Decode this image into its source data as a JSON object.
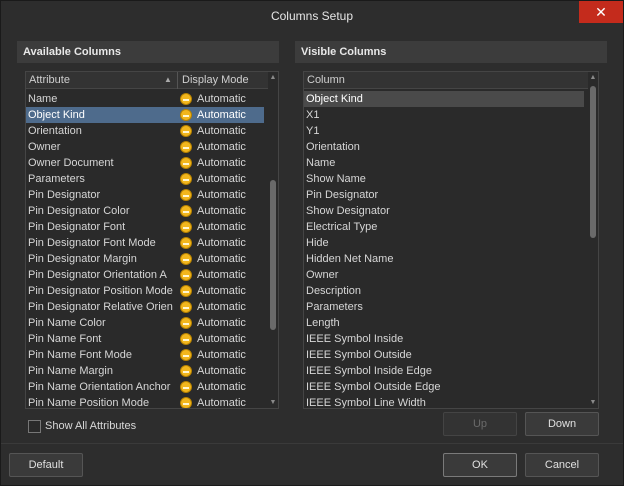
{
  "window": {
    "title": "Columns Setup"
  },
  "available": {
    "header": "Available Columns",
    "col_attribute": "Attribute",
    "col_display_mode": "Display Mode",
    "rows": [
      {
        "name": "Name",
        "mode": "Automatic"
      },
      {
        "name": "Object Kind",
        "mode": "Automatic",
        "selected": true
      },
      {
        "name": "Orientation",
        "mode": "Automatic"
      },
      {
        "name": "Owner",
        "mode": "Automatic"
      },
      {
        "name": "Owner Document",
        "mode": "Automatic"
      },
      {
        "name": "Parameters",
        "mode": "Automatic"
      },
      {
        "name": "Pin Designator",
        "mode": "Automatic"
      },
      {
        "name": "Pin Designator Color",
        "mode": "Automatic"
      },
      {
        "name": "Pin Designator Font",
        "mode": "Automatic"
      },
      {
        "name": "Pin Designator Font Mode",
        "mode": "Automatic"
      },
      {
        "name": "Pin Designator Margin",
        "mode": "Automatic"
      },
      {
        "name": "Pin Designator Orientation A",
        "mode": "Automatic"
      },
      {
        "name": "Pin Designator Position Mode",
        "mode": "Automatic"
      },
      {
        "name": "Pin Designator Relative Orien",
        "mode": "Automatic"
      },
      {
        "name": "Pin Name Color",
        "mode": "Automatic"
      },
      {
        "name": "Pin Name Font",
        "mode": "Automatic"
      },
      {
        "name": "Pin Name Font Mode",
        "mode": "Automatic"
      },
      {
        "name": "Pin Name Margin",
        "mode": "Automatic"
      },
      {
        "name": "Pin Name Orientation Anchor",
        "mode": "Automatic"
      },
      {
        "name": "Pin Name Position Mode",
        "mode": "Automatic"
      }
    ],
    "show_all_label": "Show All Attributes"
  },
  "visible": {
    "header": "Visible Columns",
    "col_column": "Column",
    "rows": [
      {
        "name": "Object Kind",
        "selected": true
      },
      {
        "name": "X1"
      },
      {
        "name": "Y1"
      },
      {
        "name": "Orientation"
      },
      {
        "name": "Name"
      },
      {
        "name": "Show Name"
      },
      {
        "name": "Pin Designator"
      },
      {
        "name": "Show Designator"
      },
      {
        "name": "Electrical Type"
      },
      {
        "name": "Hide"
      },
      {
        "name": "Hidden Net Name"
      },
      {
        "name": "Owner"
      },
      {
        "name": "Description"
      },
      {
        "name": "Parameters"
      },
      {
        "name": "Length"
      },
      {
        "name": "IEEE Symbol Inside"
      },
      {
        "name": "IEEE Symbol Outside"
      },
      {
        "name": "IEEE Symbol Inside Edge"
      },
      {
        "name": "IEEE Symbol Outside Edge"
      },
      {
        "name": "IEEE Symbol Line Width"
      }
    ],
    "up_label": "Up",
    "down_label": "Down"
  },
  "footer": {
    "default_label": "Default",
    "ok_label": "OK",
    "cancel_label": "Cancel"
  },
  "colors": {
    "accent_selection": "#4e6b8c",
    "auto_icon": "#f2b61d",
    "close": "#c42b1c"
  }
}
